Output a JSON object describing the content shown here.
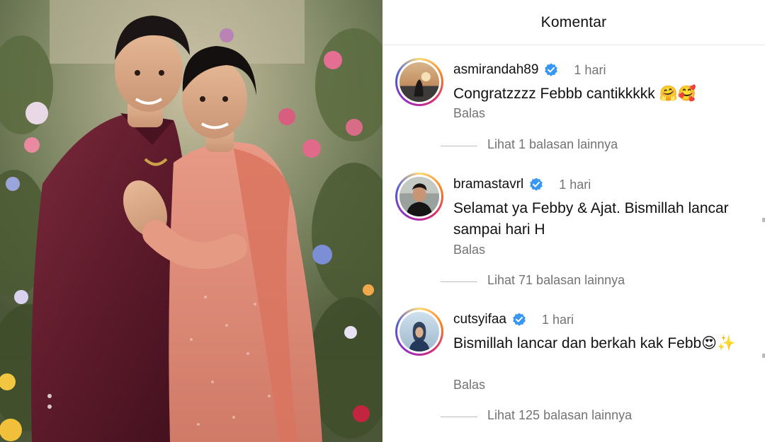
{
  "header": {
    "title": "Komentar"
  },
  "comments": [
    {
      "username": "asmirandah89",
      "verified_icon": "verified-badge-icon",
      "time": "1 hari",
      "text": "Congratzzzz Febbb cantikkkkk 🤗🥰",
      "reply_label": "Balas",
      "more_replies": "Lihat 1 balasan lainnya"
    },
    {
      "username": "bramastavrl",
      "verified_icon": "verified-badge-icon",
      "time": "1 hari",
      "text": "Selamat ya Febby & Ajat. Bismillah lancar sampai hari H",
      "reply_label": "Balas",
      "more_replies": "Lihat 71 balasan lainnya"
    },
    {
      "username": "cutsyifaa",
      "verified_icon": "verified-badge-icon",
      "time": "1 hari",
      "text": "Bismillah lancar dan berkah kak Febb😍✨",
      "reply_label": "Balas",
      "more_replies": "Lihat 125 balasan lainnya"
    }
  ],
  "colors": {
    "verified": "#3897f0",
    "muted_text": "#737373",
    "story_ring_start": "#feda75",
    "story_ring_end": "#4f5bd5"
  }
}
